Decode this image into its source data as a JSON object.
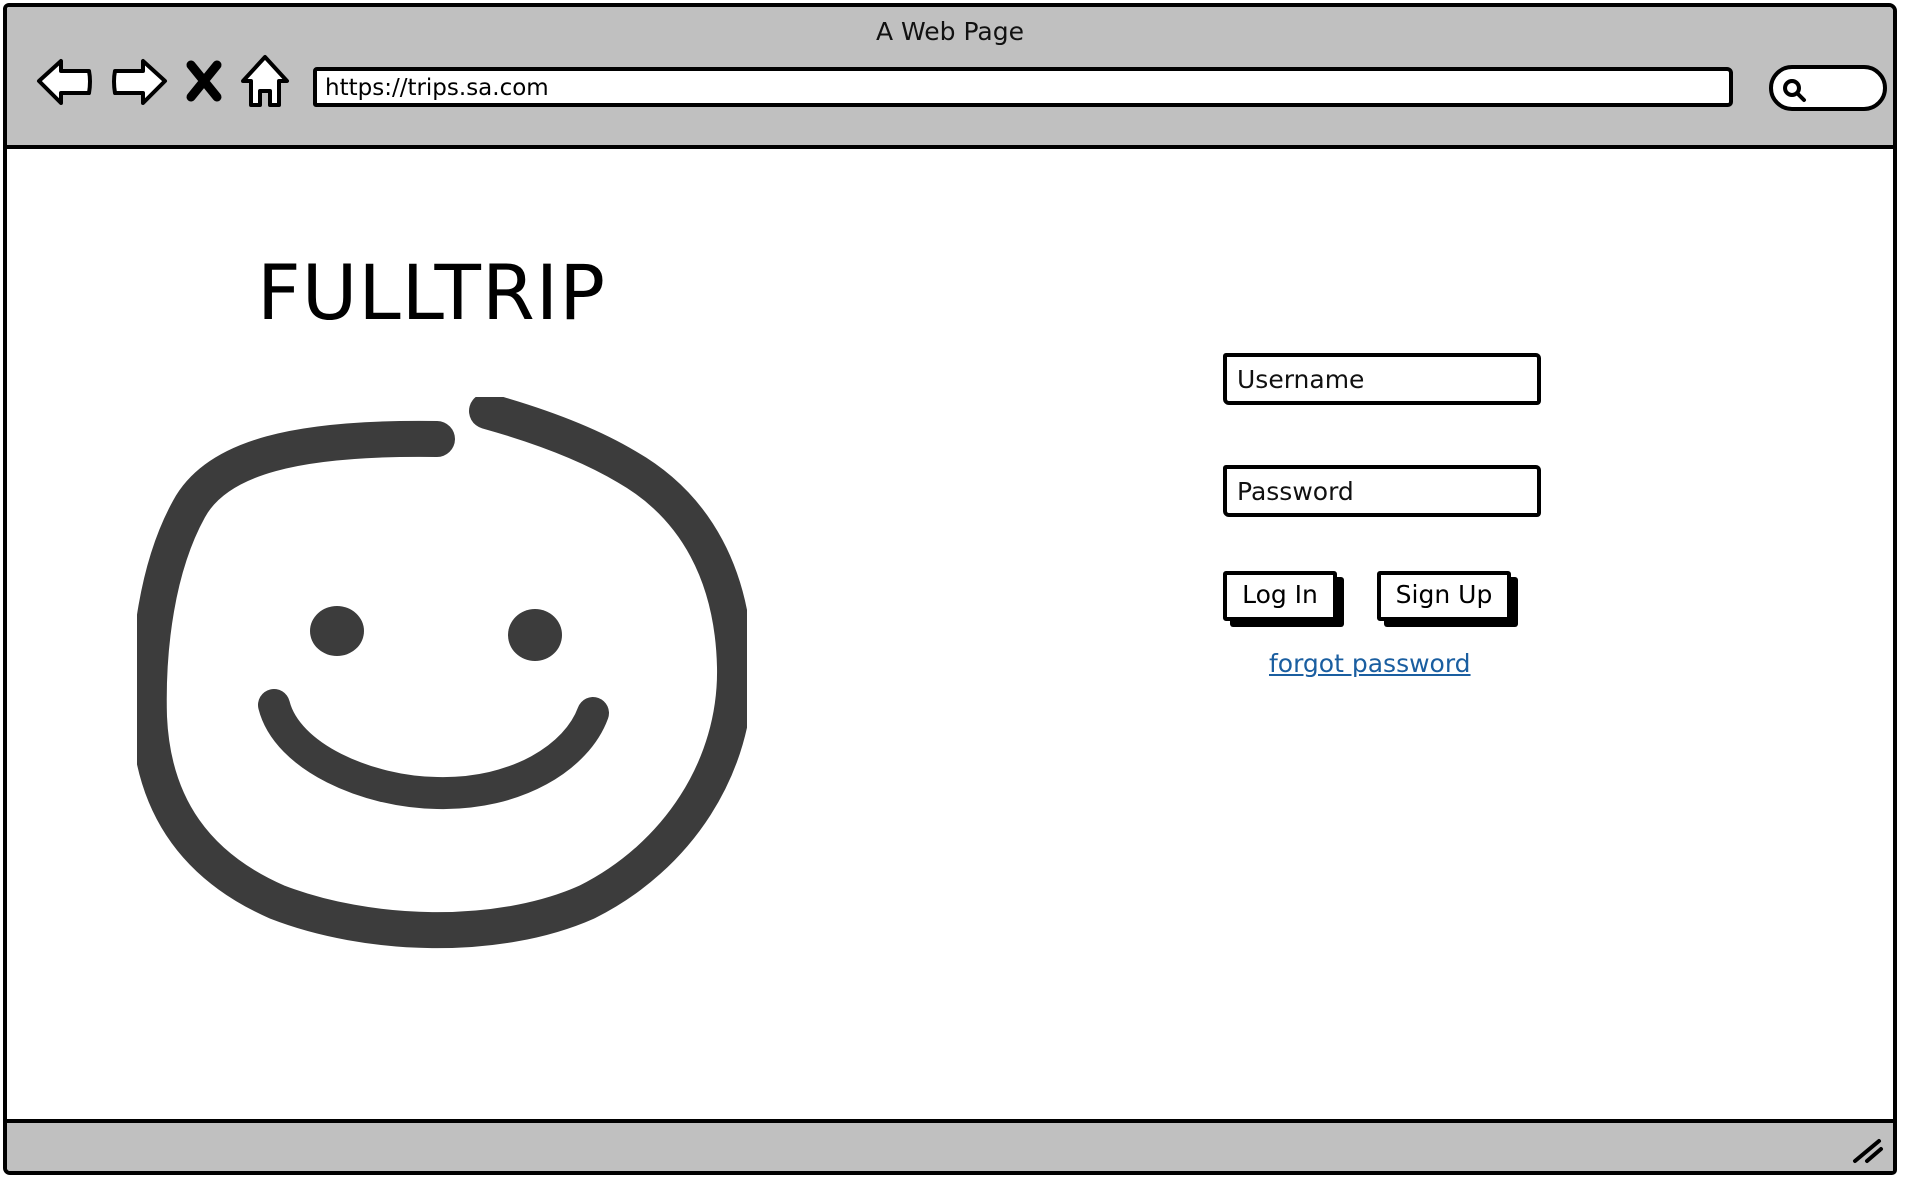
{
  "window": {
    "title": "A Web Page"
  },
  "toolbar": {
    "back_icon": "arrow-left-icon",
    "forward_icon": "arrow-right-icon",
    "stop_icon": "close-icon",
    "home_icon": "home-icon",
    "url": "https://trips.sa.com",
    "search_icon": "search-icon"
  },
  "main": {
    "logo_text": "FULLTRIP",
    "logo_icon": "smiley-icon"
  },
  "login": {
    "username_placeholder": "Username",
    "password_placeholder": "Password",
    "login_label": "Log In",
    "signup_label": "Sign Up",
    "forgot_label": "forgot password"
  },
  "colors": {
    "chrome": "#c0c0c0",
    "link": "#1a5ea0",
    "smiley": "#3c3c3c"
  }
}
